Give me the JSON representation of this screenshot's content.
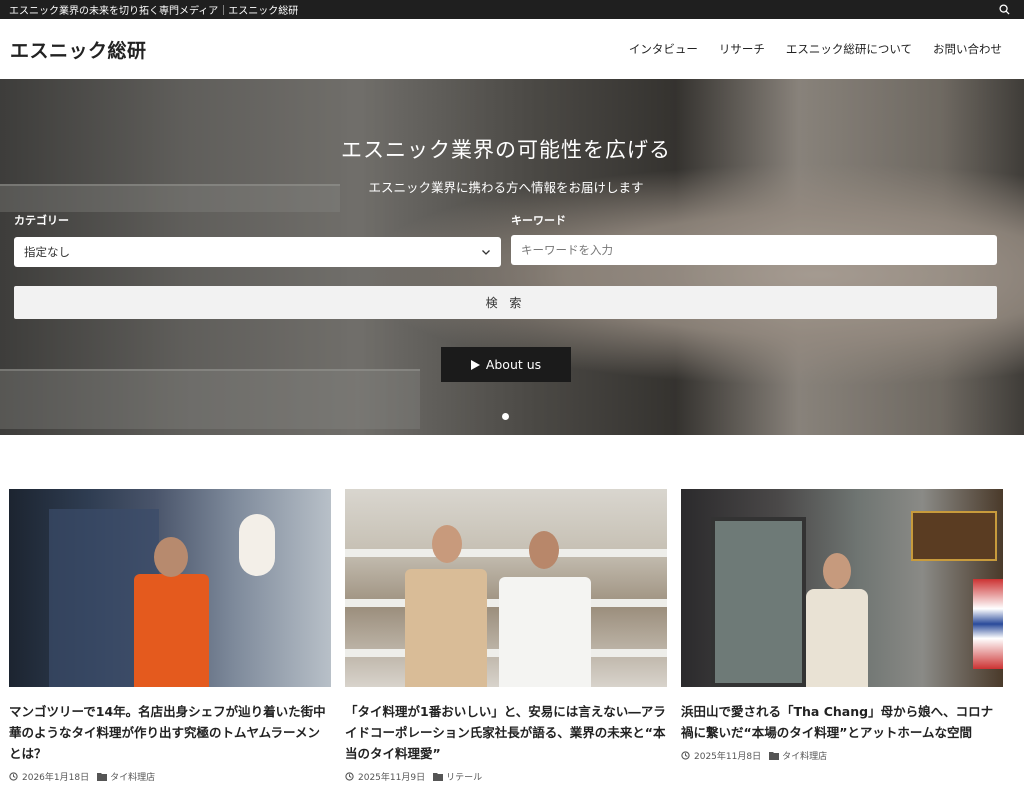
{
  "topbar": {
    "tagline": "エスニック業界の未来を切り拓く専門メディア｜エスニック総研",
    "search_icon": "search-icon"
  },
  "header": {
    "logo": "エスニック総研",
    "nav": [
      {
        "label": "インタビュー"
      },
      {
        "label": "リサーチ"
      },
      {
        "label": "エスニック総研について"
      },
      {
        "label": "お問い合わせ"
      }
    ]
  },
  "hero": {
    "title": "エスニック業界の可能性を広げる",
    "subtitle": "エスニック業界に携わる方へ情報をお届けします",
    "category_label": "カテゴリー",
    "category_value": "指定なし",
    "keyword_label": "キーワード",
    "keyword_placeholder": "キーワードを入力",
    "search_button": "検 索",
    "about_button": "About us"
  },
  "articles": [
    {
      "title": "マンゴツリーで14年。名店出身シェフが辿り着いた街中華のようなタイ料理が作り出す究極のトムヤムラーメンとは？",
      "date": "2026年1月18日",
      "category": "タイ料理店"
    },
    {
      "title": "「タイ料理が1番おいしい」と、安易には言えない―アライドコーポレーション氏家社長が語る、業界の未来と“本当のタイ料理愛”",
      "date": "2025年11月9日",
      "category": "リテール"
    },
    {
      "title": "浜田山で愛される「Tha Chang」母から娘へ、コロナ禍に繋いだ“本場のタイ料理”とアットホームな空間",
      "date": "2025年11月8日",
      "category": "タイ料理店"
    }
  ],
  "colors": {
    "topbar": "#1f1f1f",
    "about_button": "#1b1b1b"
  }
}
